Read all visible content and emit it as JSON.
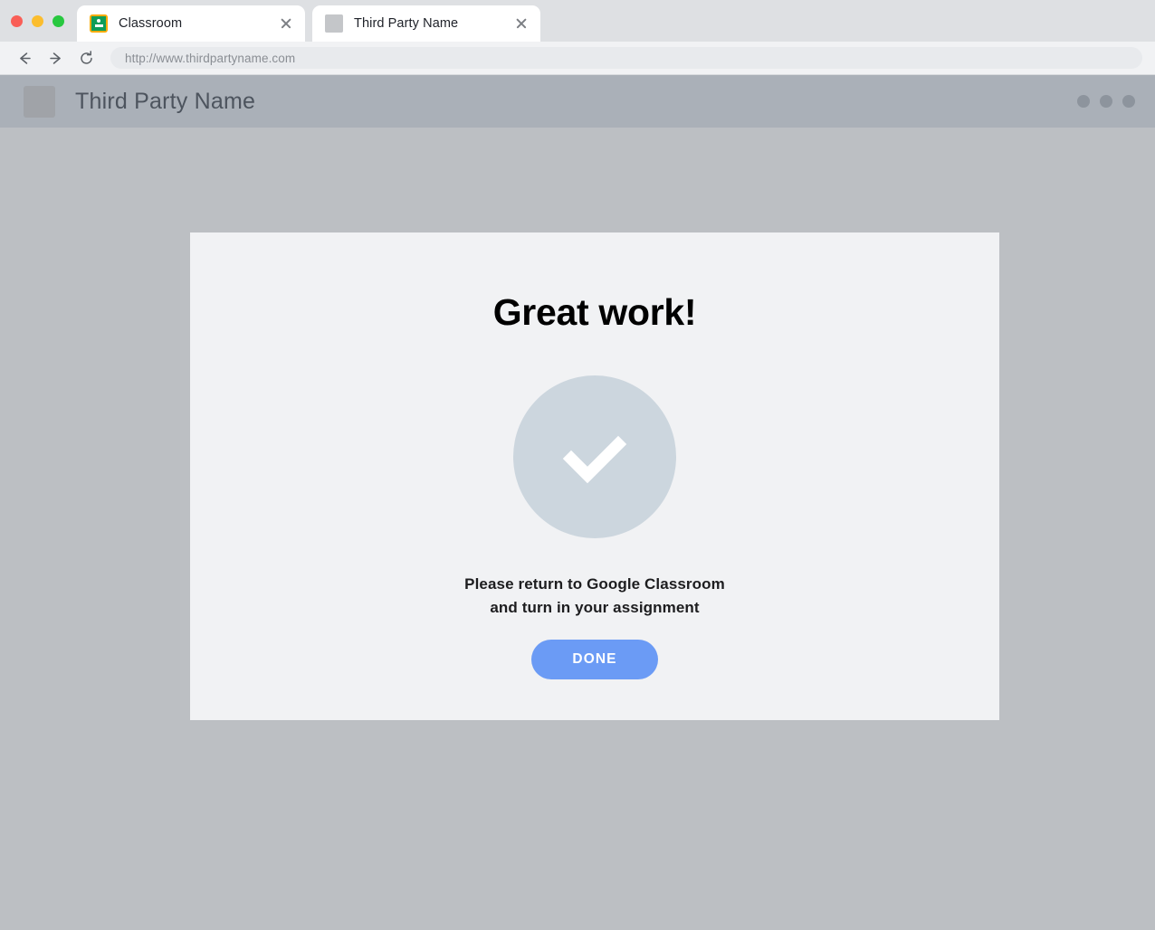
{
  "window": {
    "traffic_lights": [
      {
        "name": "close",
        "color": "#f95e57"
      },
      {
        "name": "minimize",
        "color": "#fbbd2e"
      },
      {
        "name": "zoom",
        "color": "#28c840"
      }
    ]
  },
  "browser": {
    "tabs": [
      {
        "title": "Classroom",
        "favicon": "classroom-icon",
        "active": false,
        "close_label": "×"
      },
      {
        "title": "Third Party Name",
        "favicon": "generic-site-icon",
        "active": true,
        "close_label": "×"
      }
    ],
    "toolbar": {
      "back_label": "Back",
      "forward_label": "Forward",
      "reload_label": "Reload",
      "url": "http://www.thirdpartyname.com"
    }
  },
  "site": {
    "header": {
      "title": "Third Party Name",
      "logo_label": "Third Party Name logo",
      "menu_label": "More options"
    },
    "card": {
      "title": "Great work!",
      "icon_label": "success-check",
      "message_line1": "Please return to Google Classroom",
      "message_line2": "and turn in your assignment",
      "button_label": "DONE"
    }
  },
  "colors": {
    "page_background": "#bcbfc3",
    "site_header": "#aab0b8",
    "card_background": "#f1f2f4",
    "check_circle": "#ccd6de",
    "accent_button": "#6b9bf5",
    "tabstrip": "#dee0e3",
    "toolbar": "#f1f2f4"
  }
}
